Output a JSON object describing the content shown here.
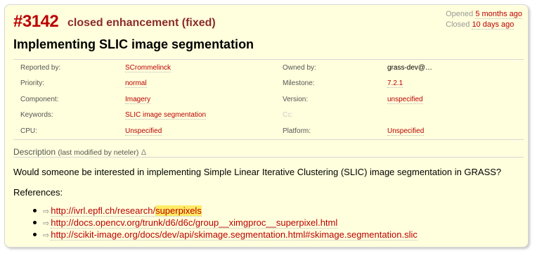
{
  "ticket": {
    "id": "#3142",
    "status": "closed",
    "type": "enhancement",
    "resolution": "(fixed)",
    "opened_label": "Opened",
    "opened_value": "5 months ago",
    "closed_label": "Closed",
    "closed_value": "10 days ago",
    "summary": "Implementing SLIC image segmentation"
  },
  "properties": {
    "reported_by_label": "Reported by:",
    "reported_by_value": "SCrommelinck",
    "owned_by_label": "Owned by:",
    "owned_by_value": "grass-dev@…",
    "priority_label": "Priority:",
    "priority_value": "normal",
    "milestone_label": "Milestone:",
    "milestone_value": "7.2.1",
    "component_label": "Component:",
    "component_value": "Imagery",
    "version_label": "Version:",
    "version_value": "unspecified",
    "keywords_label": "Keywords:",
    "keywords_value": "SLIC image segmentation",
    "cc_label": "Cc:",
    "cpu_label": "CPU:",
    "cpu_value": "Unspecified",
    "platform_label": "Platform:",
    "platform_value": "Unspecified"
  },
  "description": {
    "heading": "Description",
    "last_modified": "(last modified by neteler)",
    "delta": "Δ",
    "text": "Would someone be interested in implementing Simple Linear Iterative Clustering (SLIC) image segmentation in GRASS?",
    "references_label": "References:",
    "links": [
      {
        "prefix": "http://ivrl.epfl.ch/research/",
        "highlight": "superpixels"
      },
      {
        "prefix": "http://docs.opencv.org/trunk/d6/d6c/group__ximgproc__superpixel.html",
        "highlight": ""
      },
      {
        "prefix": "http://scikit-image.org/docs/dev/api/skimage.segmentation.html#skimage.segmentation.slic",
        "highlight": ""
      }
    ]
  },
  "icons": {
    "external_link": "external-link-icon"
  },
  "colors": {
    "ticket_bg": "#ffffdd",
    "accent": "#bb0000",
    "highlight": "#ffeb64"
  }
}
